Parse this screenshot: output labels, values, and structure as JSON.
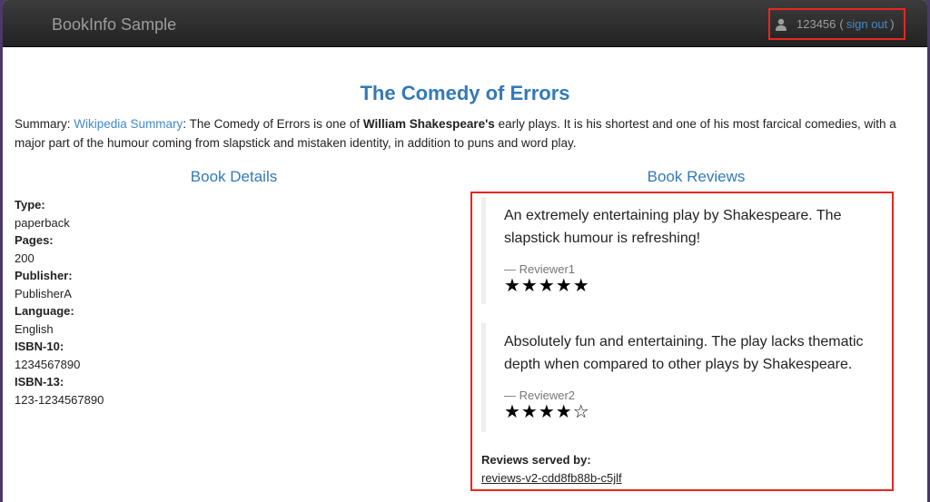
{
  "header": {
    "brand": "BookInfo Sample",
    "user_id": "123456",
    "paren_open": "(",
    "sign_out": "sign out",
    "paren_close": ")",
    "user_icon": "user-icon"
  },
  "book": {
    "title": "The Comedy of Errors",
    "summary_label": "Summary:",
    "summary_link": "Wikipedia Summary",
    "summary_text_1": ": The Comedy of Errors is one of ",
    "summary_bold": "William Shakespeare's",
    "summary_text_2": " early plays. It is his shortest and one of his most farcical comedies, with a major part of the humour coming from slapstick and mistaken identity, in addition to puns and word play."
  },
  "details": {
    "heading": "Book Details",
    "items": [
      {
        "label": "Type:",
        "value": "paperback"
      },
      {
        "label": "Pages:",
        "value": "200"
      },
      {
        "label": "Publisher:",
        "value": "PublisherA"
      },
      {
        "label": "Language:",
        "value": "English"
      },
      {
        "label": "ISBN-10:",
        "value": "1234567890"
      },
      {
        "label": "ISBN-13:",
        "value": "123-1234567890"
      }
    ]
  },
  "reviews": {
    "heading": "Book Reviews",
    "items": [
      {
        "text": "An extremely entertaining play by Shakespeare. The slapstick humour is refreshing!",
        "reviewer": "— Reviewer1",
        "stars": "★★★★★",
        "rating": 5
      },
      {
        "text": "Absolutely fun and entertaining. The play lacks thematic depth when compared to other plays by Shakespeare.",
        "reviewer": "— Reviewer2",
        "stars": "★★★★☆",
        "rating": 4
      }
    ],
    "served_by_label": "Reviews served by:",
    "served_by_pod": "reviews-v2-cdd8fb88b-c5jlf"
  },
  "colors": {
    "navbar": "#222222",
    "link": "#428bca",
    "heading": "#337ab7",
    "highlight_border": "#e8261f"
  }
}
